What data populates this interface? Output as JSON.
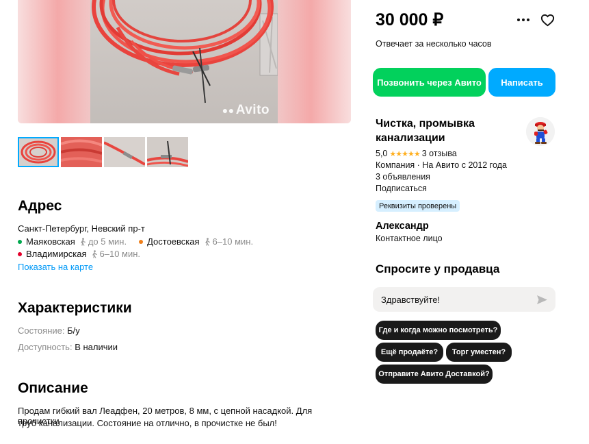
{
  "gallery": {
    "watermark": "Avito",
    "thumbnails": [
      "thumb-1",
      "thumb-2",
      "thumb-3",
      "thumb-4"
    ]
  },
  "address": {
    "title": "Адрес",
    "line": "Санкт-Петербург, Невский пр-т",
    "metro": [
      {
        "name": "Маяковская",
        "time": "до 5 мин.",
        "color": "#00a84d"
      },
      {
        "name": "Достоевская",
        "time": "6–10 мин.",
        "color": "#ef7f1a"
      },
      {
        "name": "Владимирская",
        "time": "6–10 мин.",
        "color": "#e4002b"
      }
    ],
    "map_link": "Показать на карте"
  },
  "specs": {
    "title": "Характеристики",
    "items": [
      {
        "label": "Состояние:",
        "value": "Б/у"
      },
      {
        "label": "Доступность:",
        "value": "В наличии"
      }
    ]
  },
  "description": {
    "title": "Описание",
    "line1": "Продам гибкий вал Леадфен, 20 метров, 8 мм, с цепной насадкой. Для прочистки",
    "line2": "труб канализации. Состояние на отлично, в прочистке не был!"
  },
  "offer": {
    "price": "30 000 ₽",
    "response": "Отвечает за несколько часов",
    "call_button": "Позвонить через Авито",
    "write_button": "Написать",
    "icons": {
      "more": "more-dots-icon",
      "favorite": "heart-icon"
    }
  },
  "seller": {
    "name_line1": "Чистка, промывка",
    "name_line2": "канализации",
    "rating": "5,0",
    "stars": "★★★★★",
    "reviews": "3 отзыва",
    "company": "Компания · На Авито с 2012 года",
    "ads": "3 объявления",
    "subscribe": "Подписаться",
    "verified": "Реквизиты проверены",
    "contact_name": "Александр",
    "contact_role": "Контактное лицо"
  },
  "ask": {
    "title": "Спросите у продавца",
    "input_value": "Здравствуйте!",
    "chips": [
      "Где и когда можно посмотреть?",
      "Ещё продаёте?",
      "Торг уместен?",
      "Отправите Авито Доставкой?"
    ]
  },
  "colors": {
    "accent_blue": "#00aaff",
    "accent_green": "#02d15c",
    "link": "#0099f7",
    "star": "#ffb021"
  }
}
